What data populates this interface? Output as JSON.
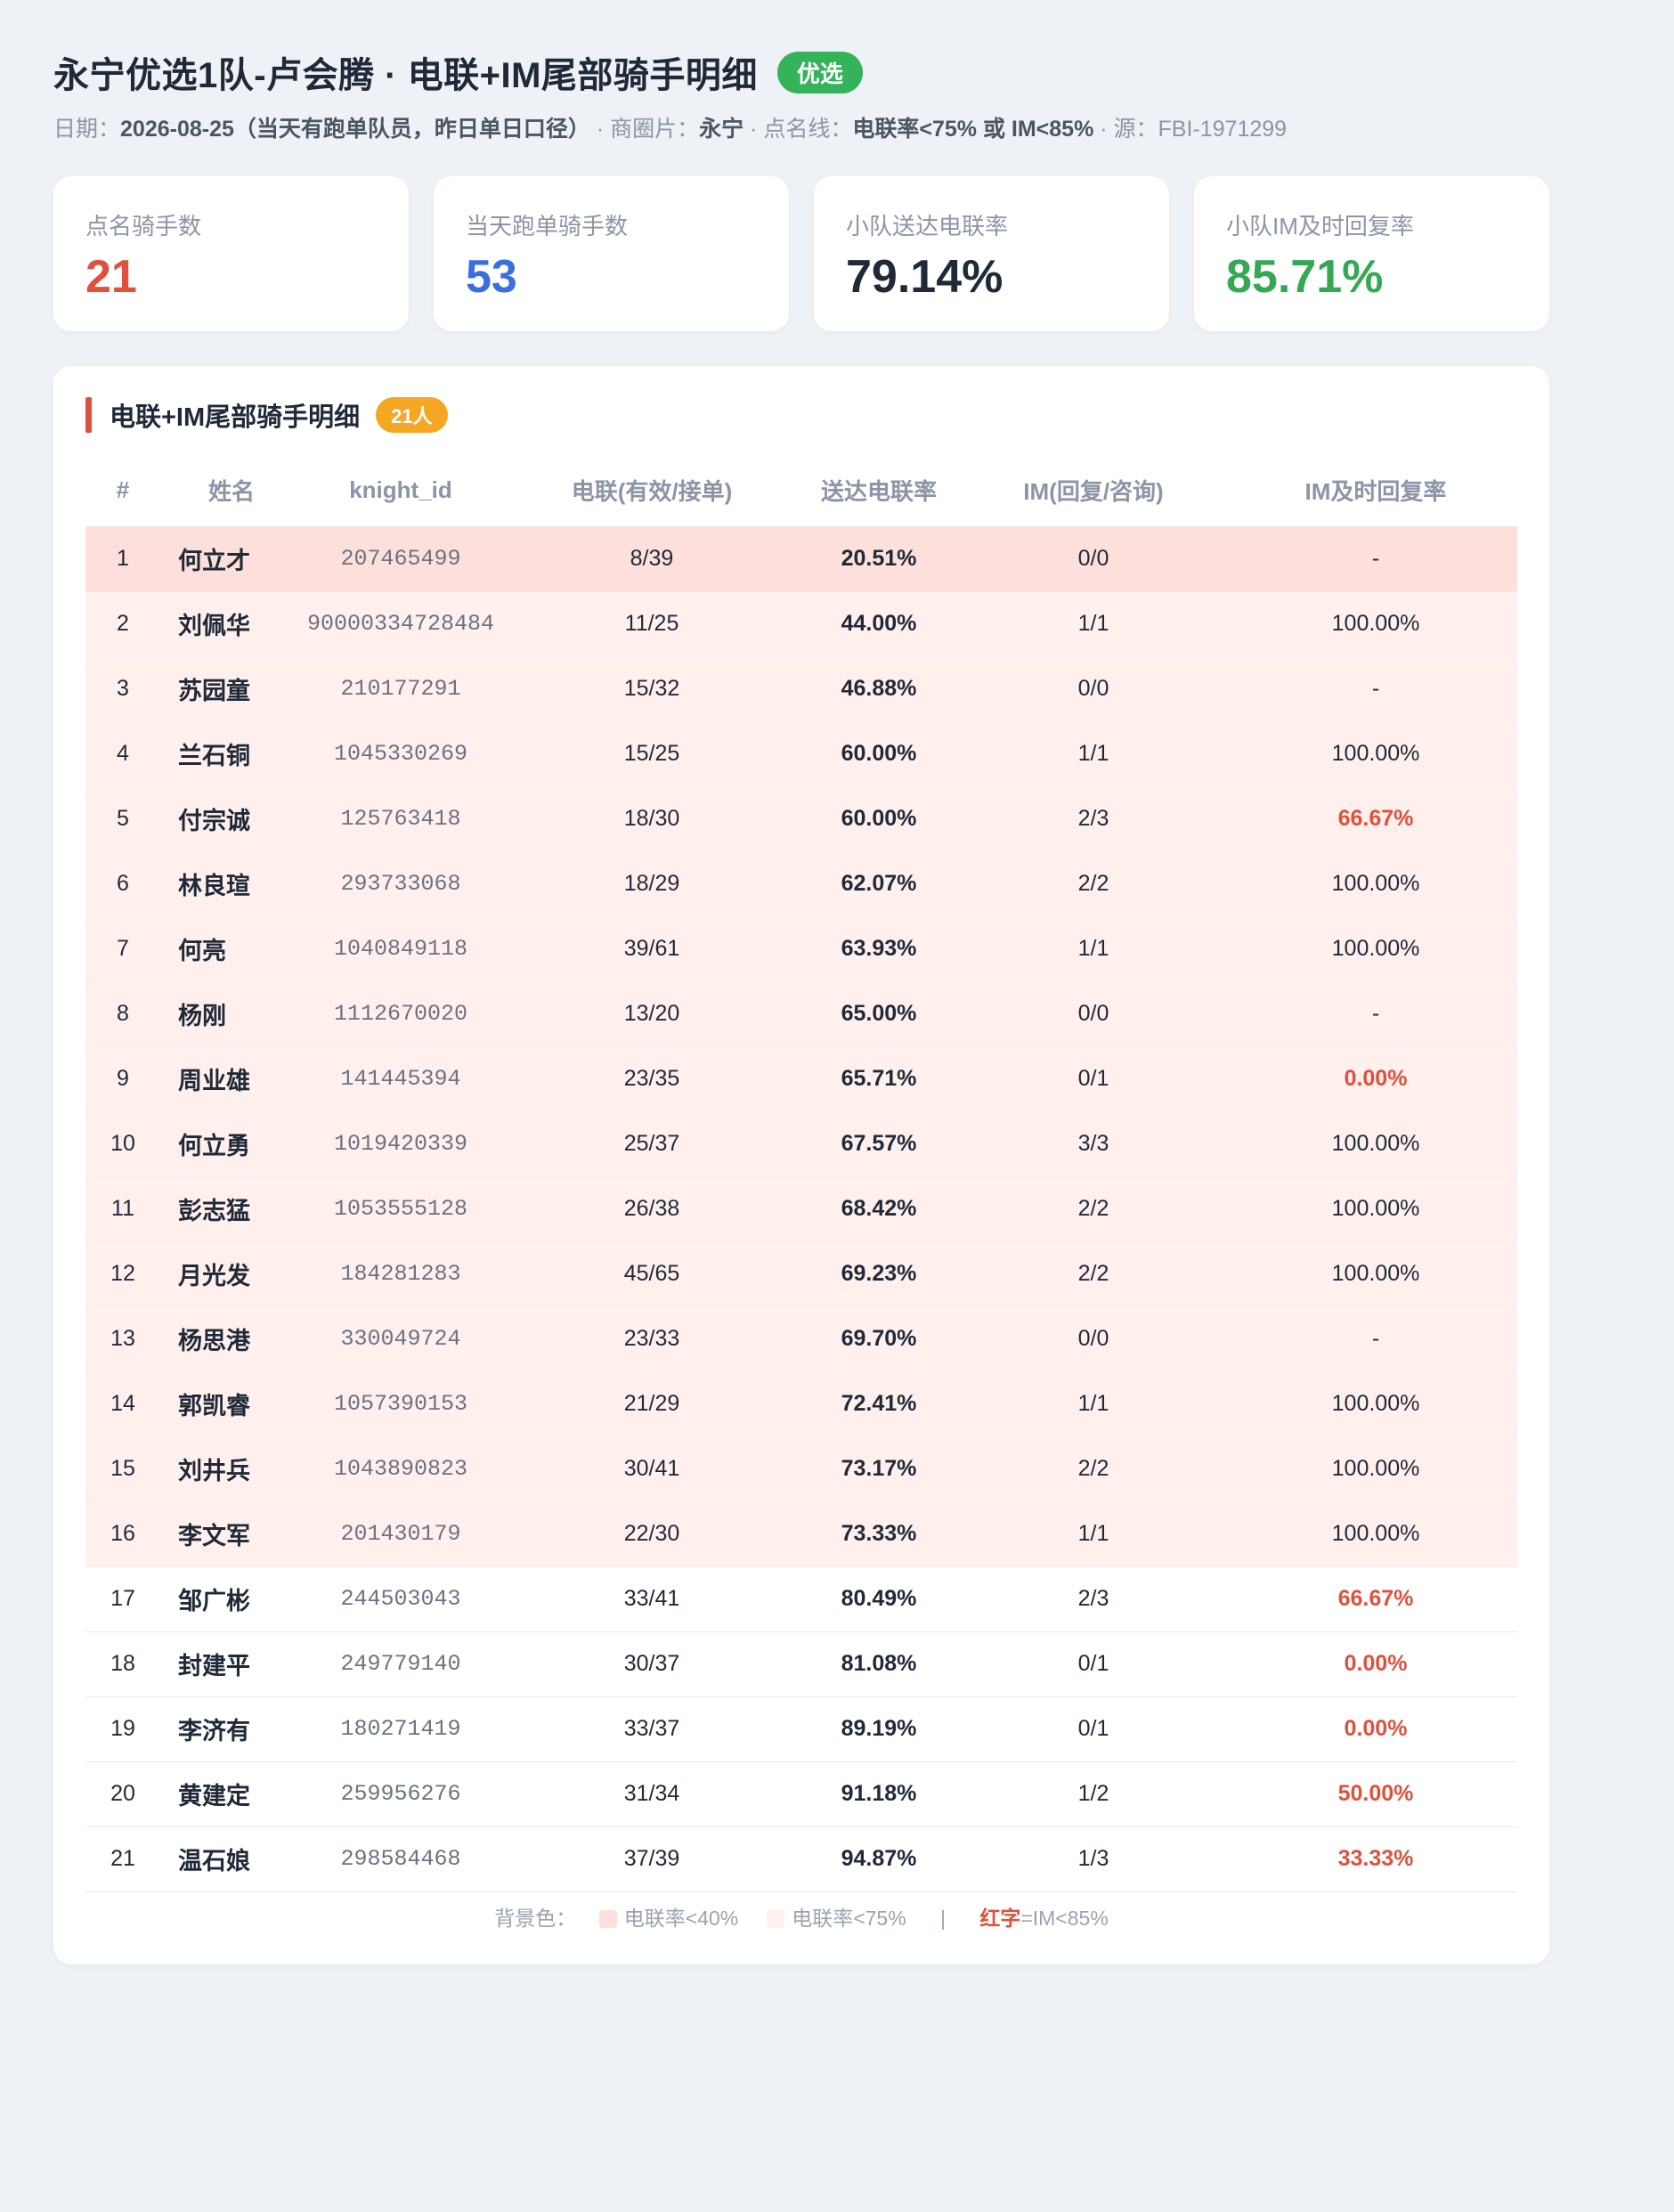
{
  "header": {
    "title": "永宁优选1队-卢会腾 · 电联+IM尾部骑手明细",
    "badge": "优选",
    "subtitle": {
      "date_label": "日期：",
      "date_value": "2026-08-25（当天有跑单队员，昨日单日口径）",
      "area_label": " · 商圈片：",
      "area_value": "永宁",
      "line_label": " · 点名线：",
      "line_value": "电联率<75% 或 IM<85%",
      "source": " · 源：FBI-1971299"
    }
  },
  "cards": [
    {
      "label": "点名骑手数",
      "value": "21",
      "color": "#e0503c"
    },
    {
      "label": "当天跑单骑手数",
      "value": "53",
      "color": "#3b6fe0"
    },
    {
      "label": "小队送达电联率",
      "value": "79.14%",
      "color": "#1f2937"
    },
    {
      "label": "小队IM及时回复率",
      "value": "85.71%",
      "color": "#34a853"
    }
  ],
  "panel": {
    "title": "电联+IM尾部骑手明细",
    "count_badge": "21人"
  },
  "table": {
    "headers": [
      "#",
      "姓名",
      "knight_id",
      "电联(有效/接单)",
      "送达电联率",
      "IM(回复/咨询)",
      "IM及时回复率"
    ],
    "rows": [
      {
        "idx": "1",
        "name": "何立才",
        "kid": "207465499",
        "call": "8/39",
        "rate": "20.51%",
        "im": "0/0",
        "imr": "-",
        "bg": "dark",
        "imr_red": false
      },
      {
        "idx": "2",
        "name": "刘佩华",
        "kid": "90000334728484",
        "call": "11/25",
        "rate": "44.00%",
        "im": "1/1",
        "imr": "100.00%",
        "bg": "light",
        "imr_red": false
      },
      {
        "idx": "3",
        "name": "苏园童",
        "kid": "210177291",
        "call": "15/32",
        "rate": "46.88%",
        "im": "0/0",
        "imr": "-",
        "bg": "light",
        "imr_red": false
      },
      {
        "idx": "4",
        "name": "兰石铜",
        "kid": "1045330269",
        "call": "15/25",
        "rate": "60.00%",
        "im": "1/1",
        "imr": "100.00%",
        "bg": "light",
        "imr_red": false
      },
      {
        "idx": "5",
        "name": "付宗诚",
        "kid": "125763418",
        "call": "18/30",
        "rate": "60.00%",
        "im": "2/3",
        "imr": "66.67%",
        "bg": "light",
        "imr_red": true
      },
      {
        "idx": "6",
        "name": "林良瑄",
        "kid": "293733068",
        "call": "18/29",
        "rate": "62.07%",
        "im": "2/2",
        "imr": "100.00%",
        "bg": "light",
        "imr_red": false
      },
      {
        "idx": "7",
        "name": "何亮",
        "kid": "1040849118",
        "call": "39/61",
        "rate": "63.93%",
        "im": "1/1",
        "imr": "100.00%",
        "bg": "light",
        "imr_red": false
      },
      {
        "idx": "8",
        "name": "杨刚",
        "kid": "1112670020",
        "call": "13/20",
        "rate": "65.00%",
        "im": "0/0",
        "imr": "-",
        "bg": "light",
        "imr_red": false
      },
      {
        "idx": "9",
        "name": "周业雄",
        "kid": "141445394",
        "call": "23/35",
        "rate": "65.71%",
        "im": "0/1",
        "imr": "0.00%",
        "bg": "light",
        "imr_red": true
      },
      {
        "idx": "10",
        "name": "何立勇",
        "kid": "1019420339",
        "call": "25/37",
        "rate": "67.57%",
        "im": "3/3",
        "imr": "100.00%",
        "bg": "light",
        "imr_red": false
      },
      {
        "idx": "11",
        "name": "彭志猛",
        "kid": "1053555128",
        "call": "26/38",
        "rate": "68.42%",
        "im": "2/2",
        "imr": "100.00%",
        "bg": "light",
        "imr_red": false
      },
      {
        "idx": "12",
        "name": "月光发",
        "kid": "184281283",
        "call": "45/65",
        "rate": "69.23%",
        "im": "2/2",
        "imr": "100.00%",
        "bg": "light",
        "imr_red": false
      },
      {
        "idx": "13",
        "name": "杨思港",
        "kid": "330049724",
        "call": "23/33",
        "rate": "69.70%",
        "im": "0/0",
        "imr": "-",
        "bg": "light",
        "imr_red": false
      },
      {
        "idx": "14",
        "name": "郭凯睿",
        "kid": "1057390153",
        "call": "21/29",
        "rate": "72.41%",
        "im": "1/1",
        "imr": "100.00%",
        "bg": "light",
        "imr_red": false
      },
      {
        "idx": "15",
        "name": "刘井兵",
        "kid": "1043890823",
        "call": "30/41",
        "rate": "73.17%",
        "im": "2/2",
        "imr": "100.00%",
        "bg": "light",
        "imr_red": false
      },
      {
        "idx": "16",
        "name": "李文军",
        "kid": "201430179",
        "call": "22/30",
        "rate": "73.33%",
        "im": "1/1",
        "imr": "100.00%",
        "bg": "light",
        "imr_red": false
      },
      {
        "idx": "17",
        "name": "邹广彬",
        "kid": "244503043",
        "call": "33/41",
        "rate": "80.49%",
        "im": "2/3",
        "imr": "66.67%",
        "bg": "none",
        "imr_red": true
      },
      {
        "idx": "18",
        "name": "封建平",
        "kid": "249779140",
        "call": "30/37",
        "rate": "81.08%",
        "im": "0/1",
        "imr": "0.00%",
        "bg": "none",
        "imr_red": true
      },
      {
        "idx": "19",
        "name": "李济有",
        "kid": "180271419",
        "call": "33/37",
        "rate": "89.19%",
        "im": "0/1",
        "imr": "0.00%",
        "bg": "none",
        "imr_red": true
      },
      {
        "idx": "20",
        "name": "黄建定",
        "kid": "259956276",
        "call": "31/34",
        "rate": "91.18%",
        "im": "1/2",
        "imr": "50.00%",
        "bg": "none",
        "imr_red": true
      },
      {
        "idx": "21",
        "name": "温石娘",
        "kid": "298584468",
        "call": "37/39",
        "rate": "94.87%",
        "im": "1/3",
        "imr": "33.33%",
        "bg": "none",
        "imr_red": true
      }
    ]
  },
  "legend": {
    "prefix": "背景色：",
    "dark_label": "电联率<40%",
    "light_label": "电联率<75%",
    "sep": "|",
    "red_word": "红字",
    "red_rest": "=IM<85%"
  },
  "colors": {
    "accent_red": "#e0503c",
    "accent_blue": "#3b6fe0",
    "accent_green": "#34a853",
    "badge_green": "#34b35a",
    "badge_orange": "#f5a623",
    "row_dark": "#fde0db",
    "row_light": "#fff0ee"
  }
}
